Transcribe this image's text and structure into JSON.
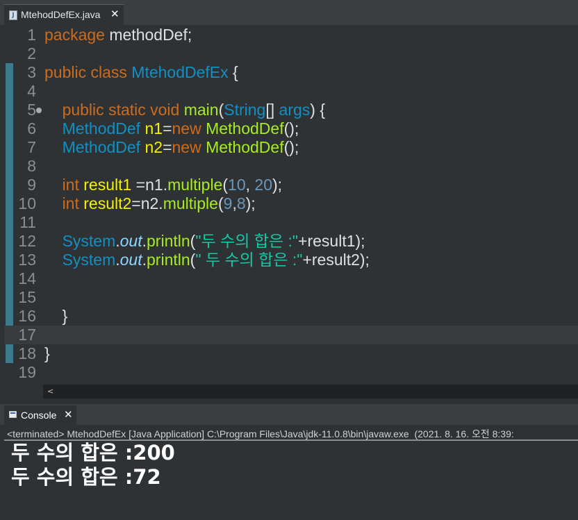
{
  "editor": {
    "tab_label": "MtehodDefEx.java",
    "tab_close": "✕",
    "file_icon": "java-file-icon",
    "fold_marker_line": 5,
    "current_line": 17,
    "lines": [
      {
        "n": "1",
        "tokens": [
          [
            "kw",
            "package"
          ],
          [
            "pl",
            " methodDef;"
          ]
        ]
      },
      {
        "n": "2",
        "tokens": []
      },
      {
        "n": "3",
        "tokens": [
          [
            "kw",
            "public"
          ],
          [
            "pl",
            " "
          ],
          [
            "kw",
            "class"
          ],
          [
            "pl",
            " "
          ],
          [
            "type",
            "MtehodDefEx"
          ],
          [
            "pl",
            " {"
          ]
        ]
      },
      {
        "n": "4",
        "tokens": []
      },
      {
        "n": "5",
        "tokens": [
          [
            "pl",
            "    "
          ],
          [
            "kw",
            "public"
          ],
          [
            "pl",
            " "
          ],
          [
            "kw",
            "static"
          ],
          [
            "pl",
            " "
          ],
          [
            "kw",
            "void"
          ],
          [
            "pl",
            " "
          ],
          [
            "method",
            "main"
          ],
          [
            "pl",
            "("
          ],
          [
            "type",
            "String"
          ],
          [
            "pl",
            "[] "
          ],
          [
            "type",
            "args"
          ],
          [
            "pl",
            ") {"
          ]
        ]
      },
      {
        "n": "6",
        "tokens": [
          [
            "pl",
            "    "
          ],
          [
            "type",
            "MethodDef"
          ],
          [
            "pl",
            " "
          ],
          [
            "var",
            "n1"
          ],
          [
            "pl",
            "="
          ],
          [
            "kw",
            "new"
          ],
          [
            "pl",
            " "
          ],
          [
            "method",
            "MethodDef"
          ],
          [
            "pl",
            "();"
          ]
        ]
      },
      {
        "n": "7",
        "tokens": [
          [
            "pl",
            "    "
          ],
          [
            "type",
            "MethodDef"
          ],
          [
            "pl",
            " "
          ],
          [
            "var",
            "n2"
          ],
          [
            "pl",
            "="
          ],
          [
            "kw",
            "new"
          ],
          [
            "pl",
            " "
          ],
          [
            "method",
            "MethodDef"
          ],
          [
            "pl",
            "();"
          ]
        ]
      },
      {
        "n": "8",
        "tokens": []
      },
      {
        "n": "9",
        "tokens": [
          [
            "pl",
            "    "
          ],
          [
            "kw",
            "int"
          ],
          [
            "pl",
            " "
          ],
          [
            "var",
            "result1"
          ],
          [
            "pl",
            " =n1."
          ],
          [
            "method",
            "multiple"
          ],
          [
            "pl",
            "("
          ],
          [
            "num",
            "10"
          ],
          [
            "pl",
            ", "
          ],
          [
            "num",
            "20"
          ],
          [
            "pl",
            ");"
          ]
        ]
      },
      {
        "n": "10",
        "tokens": [
          [
            "pl",
            "    "
          ],
          [
            "kw",
            "int"
          ],
          [
            "pl",
            " "
          ],
          [
            "var",
            "result2"
          ],
          [
            "pl",
            "=n2."
          ],
          [
            "method",
            "multiple"
          ],
          [
            "pl",
            "("
          ],
          [
            "num",
            "9"
          ],
          [
            "pl",
            ","
          ],
          [
            "num",
            "8"
          ],
          [
            "pl",
            ");"
          ]
        ]
      },
      {
        "n": "11",
        "tokens": []
      },
      {
        "n": "12",
        "tokens": [
          [
            "pl",
            "    "
          ],
          [
            "type",
            "System"
          ],
          [
            "pl",
            "."
          ],
          [
            "field",
            "out"
          ],
          [
            "pl",
            "."
          ],
          [
            "method",
            "println"
          ],
          [
            "pl",
            "("
          ],
          [
            "str",
            "\"두 수의 합은 :\""
          ],
          [
            "pl",
            "+result1);"
          ]
        ]
      },
      {
        "n": "13",
        "tokens": [
          [
            "pl",
            "    "
          ],
          [
            "type",
            "System"
          ],
          [
            "pl",
            "."
          ],
          [
            "field",
            "out"
          ],
          [
            "pl",
            "."
          ],
          [
            "method",
            "println"
          ],
          [
            "pl",
            "("
          ],
          [
            "str",
            "\" 두 수의 합은 :\""
          ],
          [
            "pl",
            "+result2);"
          ]
        ]
      },
      {
        "n": "14",
        "tokens": []
      },
      {
        "n": "15",
        "tokens": []
      },
      {
        "n": "16",
        "tokens": [
          [
            "pl",
            "    }"
          ]
        ]
      },
      {
        "n": "17",
        "tokens": []
      },
      {
        "n": "18",
        "tokens": [
          [
            "pl",
            "}"
          ]
        ]
      },
      {
        "n": "19",
        "tokens": []
      }
    ],
    "scroll_arrow": "<"
  },
  "console": {
    "tab_label": "Console",
    "tab_close": "✕",
    "icon": "console-icon",
    "status": "<terminated> MtehodDefEx [Java Application] C:\\Program Files\\Java\\jdk-11.0.8\\bin\\javaw.exe  (2021. 8. 16. 오전 8:39:",
    "output": [
      "두 수의 합은 :200",
      "두 수의 합은 :72"
    ]
  },
  "colors": {
    "keyword": "#cc6c1d",
    "type": "#1290c3",
    "variable": "#f2f200",
    "method": "#a7ec21",
    "number": "#6897bb",
    "string": "#17c6a3",
    "background": "#2f3235"
  }
}
